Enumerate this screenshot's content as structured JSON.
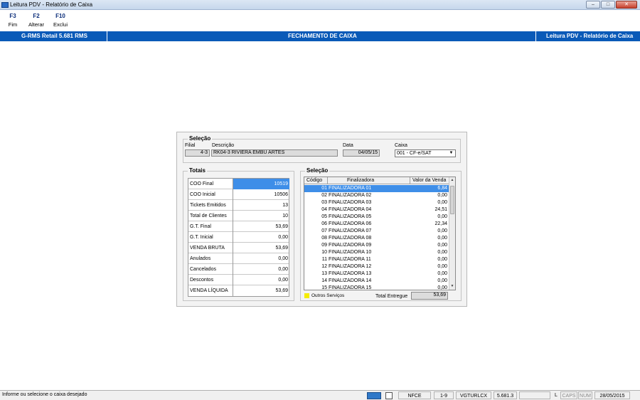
{
  "window": {
    "title": "Leitura PDV - Relatório de Caixa",
    "minimize": "–",
    "maximize": "□",
    "close": "✕"
  },
  "toolbar": [
    {
      "key": "F3",
      "label": "Fim"
    },
    {
      "key": "F2",
      "label": "Alterar"
    },
    {
      "key": "F10",
      "label": "Exclui"
    }
  ],
  "header": {
    "left": "G-RMS Retail 5.681 RMS",
    "center": "FECHAMENTO DE CAIXA",
    "right": "Leitura PDV - Relatório de Caixa"
  },
  "selecao_top": {
    "title": "Seleção",
    "filial_label": "Filial",
    "filial_value": "4-3",
    "descricao_label": "Descrição",
    "descricao_value": "RK04-3 RIVIERA EMBÚ ARTES",
    "data_label": "Data",
    "data_value": "04/05/15",
    "caixa_label": "Caixa",
    "caixa_value": "001 - CF-e/SAT"
  },
  "totais": {
    "title": "Totais",
    "rows": [
      {
        "label": "COO Final",
        "value": "10519"
      },
      {
        "label": "COO Inicial",
        "value": "10506"
      },
      {
        "label": "Tickets Emitidos",
        "value": "13"
      },
      {
        "label": "Total de Clientes",
        "value": "10"
      },
      {
        "label": "G.T. Final",
        "value": "53,69"
      },
      {
        "label": "G.T. Inicial",
        "value": "0,00"
      },
      {
        "label": "VENDA BRUTA",
        "value": "53,69"
      },
      {
        "label": "Anulados",
        "value": "0,00"
      },
      {
        "label": "Cancelados",
        "value": "0,00"
      },
      {
        "label": "Descontos",
        "value": "0,00"
      },
      {
        "label": "VENDA LÍQUIDA",
        "value": "53,69"
      }
    ]
  },
  "selecao_grid": {
    "title": "Seleção",
    "columns": [
      "Código",
      "Finalizadora",
      "Valor da Venda"
    ],
    "rows": [
      {
        "code": "01",
        "name": "FINALIZADORA 01",
        "value": "6,84"
      },
      {
        "code": "02",
        "name": "FINALIZADORA 02",
        "value": "0,00"
      },
      {
        "code": "03",
        "name": "FINALIZADORA 03",
        "value": "0,00"
      },
      {
        "code": "04",
        "name": "FINALIZADORA 04",
        "value": "24,51"
      },
      {
        "code": "05",
        "name": "FINALIZADORA 05",
        "value": "0,00"
      },
      {
        "code": "06",
        "name": "FINALIZADORA 06",
        "value": "22,34"
      },
      {
        "code": "07",
        "name": "FINALIZADORA 07",
        "value": "0,00"
      },
      {
        "code": "08",
        "name": "FINALIZADORA 08",
        "value": "0,00"
      },
      {
        "code": "09",
        "name": "FINALIZADORA 09",
        "value": "0,00"
      },
      {
        "code": "10",
        "name": "FINALIZADORA 10",
        "value": "0,00"
      },
      {
        "code": "11",
        "name": "FINALIZADORA 11",
        "value": "0,00"
      },
      {
        "code": "12",
        "name": "FINALIZADORA 12",
        "value": "0,00"
      },
      {
        "code": "13",
        "name": "FINALIZADORA 13",
        "value": "0,00"
      },
      {
        "code": "14",
        "name": "FINALIZADORA 14",
        "value": "0,00"
      },
      {
        "code": "15",
        "name": "FINALIZADORA 15",
        "value": "0,00"
      }
    ],
    "legend_label": "Outros Serviços",
    "total_label": "Total Entregue",
    "total_value": "53,69"
  },
  "statusbar": {
    "message": "Informe ou selecione o caixa desejado",
    "cells": [
      "NFCE",
      "1-9",
      "VGTURLCX",
      "5.681.3",
      "",
      "L",
      "CAPS",
      "NUM",
      "28/05/2015"
    ]
  },
  "colors": {
    "header_blue": "#0a5ab8",
    "selection_blue": "#3e8ee8",
    "legend_yellow": "#f5ec00"
  }
}
